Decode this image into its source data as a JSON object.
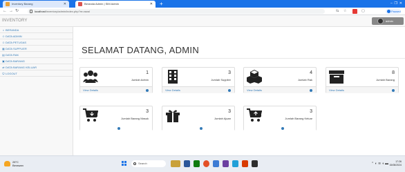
{
  "browser": {
    "tabs": [
      {
        "label": "Inventory Barang",
        "active": false
      },
      {
        "label": "Beranda Admin | SIM Admin",
        "active": true
      }
    ],
    "url_host": "localhost",
    "url_path": "/inventory/admin/index.php?m=awal",
    "profile_label": "Paused"
  },
  "app": {
    "brand": "INVENTORY",
    "user": "admin"
  },
  "sidebar": {
    "items": [
      {
        "icon": "home-icon",
        "glyph": "⌂",
        "label": "BERANDA"
      },
      {
        "icon": "user-icon",
        "glyph": "☺",
        "label": "DATA ADMIN"
      },
      {
        "icon": "users-icon",
        "glyph": "☺",
        "label": "DATA PETUGAS"
      },
      {
        "icon": "table-icon",
        "glyph": "▦",
        "label": "DATA SUPPLIER"
      },
      {
        "icon": "rack-icon",
        "glyph": "▤",
        "label": "DATA RAK"
      },
      {
        "icon": "box-icon",
        "glyph": "▣",
        "label": "DATA BARANG"
      },
      {
        "icon": "cart-icon",
        "glyph": "⇄",
        "label": "DATA BARANG KELUAR"
      },
      {
        "icon": "logout-icon",
        "glyph": "⏻",
        "label": "LOGOUT"
      }
    ]
  },
  "main": {
    "title": "SELAMAT DATANG, ADMIN",
    "view_details": "View Details",
    "cards": [
      {
        "icon": "users-icon",
        "value": "1",
        "label": "Jumlah Admin"
      },
      {
        "icon": "building-icon",
        "value": "3",
        "label": "Jumlah Supplier"
      },
      {
        "icon": "cubes-icon",
        "value": "4",
        "label": "Jumlah Rak"
      },
      {
        "icon": "archive-icon",
        "value": "8",
        "label": "Jumlah Barang"
      },
      {
        "icon": "cart-in-icon",
        "value": "3",
        "label": "Jumlah Barang Masuk"
      },
      {
        "icon": "gift-icon",
        "value": "3",
        "label": "Jumlah Ajuan"
      },
      {
        "icon": "cart-out-icon",
        "value": "3",
        "label": "Jumlah Barang Keluar"
      }
    ]
  },
  "taskbar": {
    "weather_temp": "28°C",
    "weather_desc": "Berawan",
    "search_label": "Search",
    "time": "17:26",
    "date": "15/08/2024"
  },
  "colors": {
    "link": "#337ab7",
    "browser_bar": "#1a73e8",
    "sidebar_bg": "#f8f8f8"
  }
}
